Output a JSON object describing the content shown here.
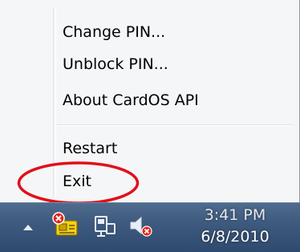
{
  "context_menu": {
    "items": [
      {
        "label": "Change PIN..."
      },
      {
        "label": "Unblock PIN..."
      },
      {
        "label": "About CardOS API"
      }
    ],
    "items_after_separator": [
      {
        "label": "Restart"
      },
      {
        "label": "Exit"
      }
    ],
    "highlight_color": "#e0101a"
  },
  "taskbar": {
    "tray_icons": [
      "show-hidden-icons-arrow",
      "cardos-api-icon",
      "network-icon",
      "speaker-muted-icon"
    ],
    "clock": {
      "time": "3:41 PM",
      "date": "6/8/2010"
    }
  }
}
